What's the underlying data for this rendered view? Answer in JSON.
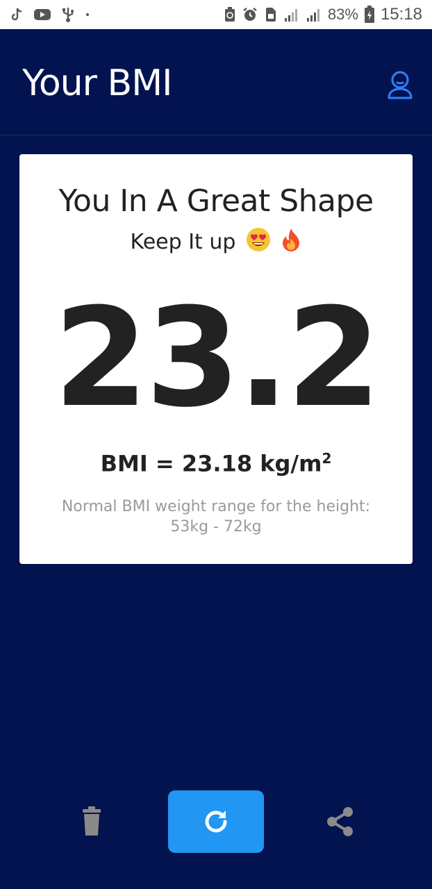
{
  "status_bar": {
    "battery": "83%",
    "time": "15:18"
  },
  "app_bar": {
    "title": "Your BMI"
  },
  "result": {
    "headline": "You In A Great Shape",
    "subline": "Keep It up",
    "bmi_big": "23.2",
    "bmi_prefix": "BMI = ",
    "bmi_value": "23.18",
    "bmi_unit": "kg/m",
    "bmi_unit_exp": "2",
    "range_label": "Normal BMI weight range for the height:",
    "range_value": "53kg - 72kg"
  },
  "actions": {
    "delete_icon": "trash-icon",
    "refresh_icon": "refresh-icon",
    "share_icon": "share-icon"
  },
  "colors": {
    "background": "#02134f",
    "card": "#ffffff",
    "accent": "#2196f3",
    "icon_gray": "#8a8a8a",
    "profile_icon": "#2f7cf6"
  }
}
